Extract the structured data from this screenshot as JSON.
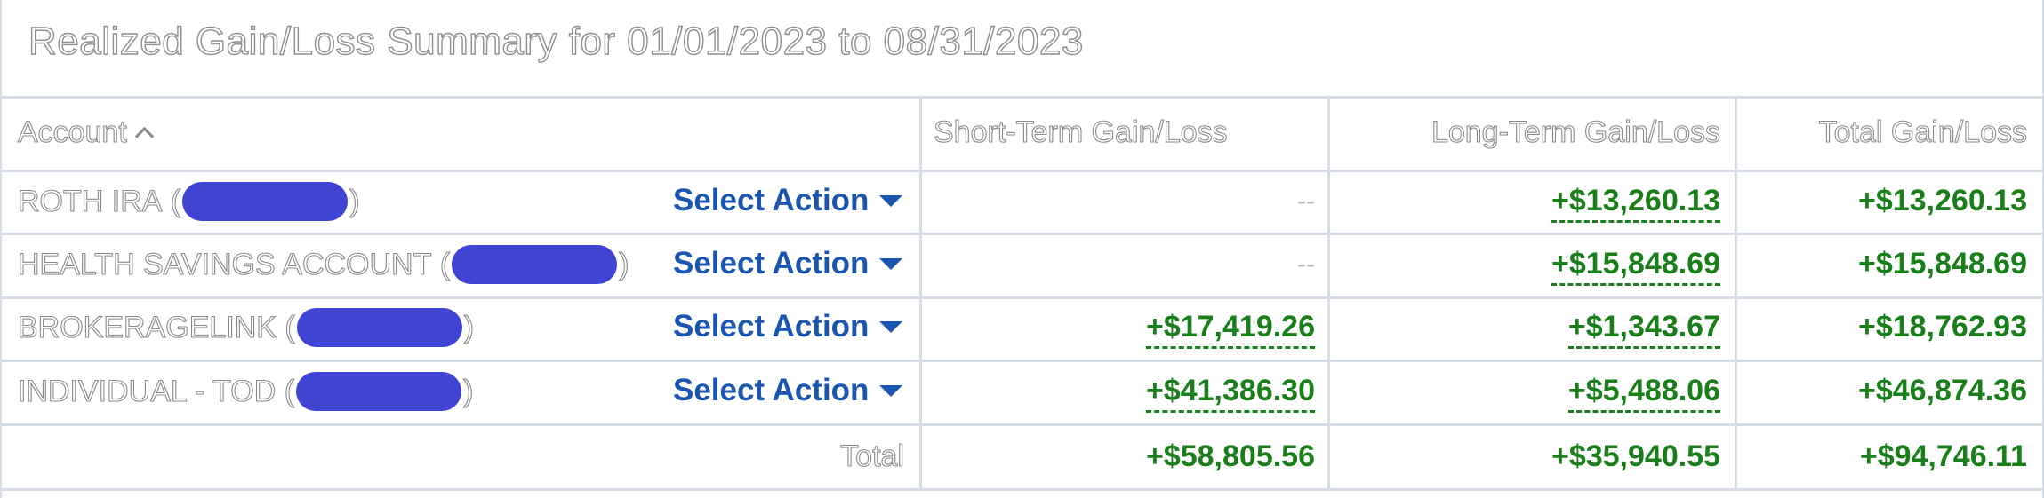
{
  "title": "Realized Gain/Loss Summary for 01/01/2023 to 08/31/2023",
  "headers": {
    "account": "Account",
    "short_term": "Short-Term Gain/Loss",
    "long_term": "Long-Term Gain/Loss",
    "total": "Total Gain/Loss"
  },
  "action_label": "Select Action",
  "rows": [
    {
      "account": "ROTH IRA",
      "short_term": "--",
      "long_term": "+$13,260.13",
      "total": "+$13,260.13"
    },
    {
      "account": "HEALTH SAVINGS ACCOUNT",
      "short_term": "--",
      "long_term": "+$15,848.69",
      "total": "+$15,848.69"
    },
    {
      "account": "BROKERAGELINK",
      "short_term": "+$17,419.26",
      "long_term": "+$1,343.67",
      "total": "+$18,762.93"
    },
    {
      "account": "INDIVIDUAL - TOD",
      "short_term": "+$41,386.30",
      "long_term": "+$5,488.06",
      "total": "+$46,874.36"
    }
  ],
  "totals": {
    "label": "Total",
    "short_term": "+$58,805.56",
    "long_term": "+$35,940.55",
    "total": "+$94,746.11"
  },
  "colors": {
    "gain": "#1a7f1a",
    "link": "#1a55b0",
    "redaction": "#3f44d2",
    "grid": "#d6dde6"
  }
}
